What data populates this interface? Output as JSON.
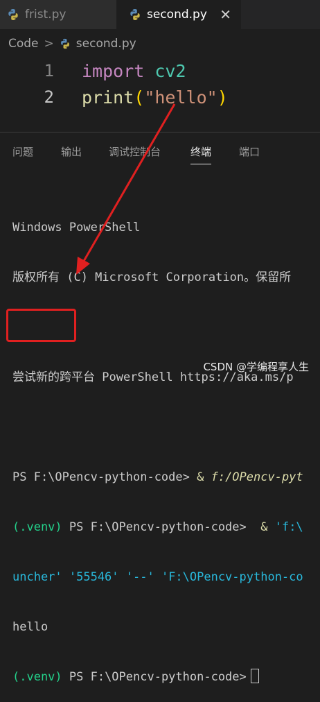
{
  "tabs": [
    {
      "label": "frist.py",
      "active": false,
      "icon": "python-icon"
    },
    {
      "label": "second.py",
      "active": true,
      "icon": "python-icon",
      "close": "✕"
    }
  ],
  "breadcrumb": {
    "folder": "Code",
    "separator": ">",
    "file": "second.py",
    "file_icon": "python-icon"
  },
  "editor": {
    "lines": [
      {
        "number": "1",
        "tokens": [
          "import",
          "cv2"
        ]
      },
      {
        "number": "2",
        "tokens": [
          "print",
          "(",
          "\"hello\"",
          ")"
        ]
      }
    ]
  },
  "panel": {
    "tabs": [
      "问题",
      "输出",
      "调试控制台",
      "终端",
      "端口"
    ],
    "active_tab": "终端"
  },
  "terminal": {
    "banner1": "Windows PowerShell",
    "banner2": "版权所有 (C) Microsoft Corporation。保留所",
    "tip": "尝试新的跨平台 PowerShell https://aka.ms/p",
    "cmd1_prompt": "PS F:\\OPencv-python-code>",
    "cmd1_rest_amp": " & ",
    "cmd1_path": "f:/OPencv-pyt",
    "venv": "(.venv)",
    "cmd2_prompt": " PS F:\\OPencv-python-code>",
    "cmd2_amp": "  & ",
    "cmd2_str": "'f:\\",
    "launcher_a": "uncher' '55546' '--' ",
    "launcher_b": "'F:\\OPencv-python-co",
    "output": "hello",
    "cmd3_prompt": " PS F:\\OPencv-python-code>"
  },
  "colors": {
    "annotation": "#e02020",
    "venv": "#23d18b",
    "keyword": "#c586c0",
    "module": "#4ec9b0",
    "string": "#ce9178"
  },
  "watermark": "CSDN @学编程享人生"
}
